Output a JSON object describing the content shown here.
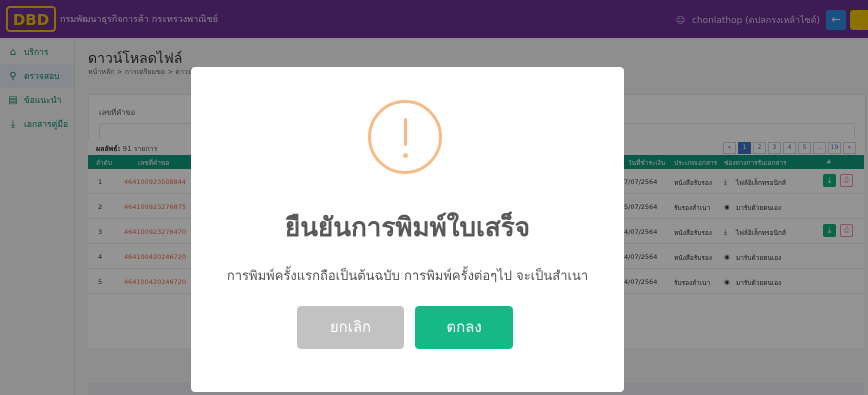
{
  "header": {
    "logo_text": "DBD",
    "department": "กรมพัฒนาธุรกิจการค้า กระทรวงพาณิชย์",
    "user": "chonlathop (ดปลกรงเหล้าไซต์)",
    "back_icon": "arrow-left-icon",
    "colors": {
      "bar": "#6b2f93",
      "logo": "#f2c200",
      "back": "#2f8be0"
    }
  },
  "sidebar": {
    "items": [
      {
        "label": "บริการ",
        "icon": "home-icon"
      },
      {
        "label": "ตรวจสอบ",
        "icon": "search-icon"
      },
      {
        "label": "ข้อแนะนำ",
        "icon": "book-icon"
      },
      {
        "label": "เอกสารคู่มือ",
        "icon": "download-icon"
      }
    ]
  },
  "main": {
    "title": "ดาวน์โหลดไฟล์",
    "breadcrumb": "หน้าหลัก  >  การเตรียมขอ  >  ดาวน์โหลด",
    "search_label": "เลขที่คำขอ",
    "count_label": "ผลลัพธ์:",
    "count_value": "91 รายการ",
    "pager": [
      "«",
      "1",
      "2",
      "3",
      "4",
      "5",
      "...",
      "19",
      "»"
    ],
    "table": {
      "headers": [
        "ลำดับ",
        "เลขที่คำขอ",
        "วันที่ชำระเงิน",
        "ประเภทเอกสาร",
        "ช่องทางการรับเอกสาร",
        "#"
      ],
      "rows": [
        {
          "no": "1",
          "req": "464100923508844",
          "date": "7/07/2564",
          "doctype": "หนังสือรับรอง",
          "channel": "ไฟล์อิเล็กทรอนิกส์",
          "channel_icon": "download-icon",
          "actions": true
        },
        {
          "no": "2",
          "req": "464100923276875",
          "date": "5/07/2564",
          "doctype": "รับรองสำเนา",
          "channel": "มารับด้วยตนเอง",
          "channel_icon": "eye-icon",
          "actions": false
        },
        {
          "no": "3",
          "req": "464100923276470",
          "date": "4/07/2564",
          "doctype": "หนังสือรับรอง",
          "channel": "ไฟล์อิเล็กทรอนิกส์",
          "channel_icon": "download-icon",
          "actions": true
        },
        {
          "no": "4",
          "req": "464100420246720",
          "date": "4/07/2564",
          "doctype": "หนังสือรับรอง",
          "channel": "มารับด้วยตนเอง",
          "channel_icon": "eye-icon",
          "actions": false
        },
        {
          "no": "5",
          "req": "464100420246720",
          "date": "4/07/2564",
          "doctype": "รับรองสำเนา",
          "channel": "มารับด้วยตนเอง",
          "channel_icon": "eye-icon",
          "actions": false
        }
      ]
    }
  },
  "modal": {
    "icon": "warning-icon",
    "title": "ยืนยันการพิมพ์ใบเสร็จ",
    "text": "การพิมพ์ครั้งแรกถือเป็นต้นฉบับ การพิมพ์ครั้งต่อๆไป จะเป็นสำเนา",
    "cancel_label": "ยกเลิก",
    "confirm_label": "ตกลง",
    "colors": {
      "warning": "#f8bb86",
      "confirm": "#16b985",
      "cancel": "#c2c2c2"
    }
  }
}
